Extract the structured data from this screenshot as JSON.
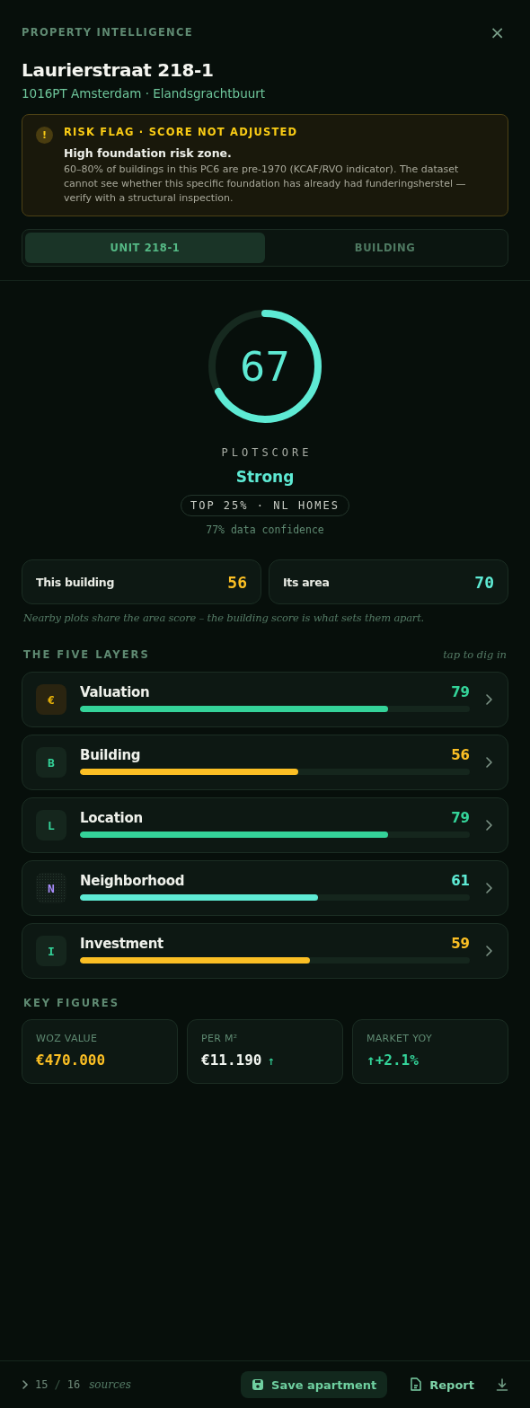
{
  "header": {
    "eyebrow": "PROPERTY INTELLIGENCE",
    "close": "×",
    "title": "Laurierstraat 218-1",
    "subtitle": "1016PT Amsterdam · Elandsgrachtbuurt"
  },
  "alert": {
    "icon": "!",
    "title": "RISK FLAG · SCORE NOT ADJUSTED",
    "headline": "High foundation risk zone.",
    "body": "60–80% of buildings in this PC6 are pre-1970 (KCAF/RVO indicator). The dataset cannot see whether this specific foundation has already had funderingsherstel — verify with a structural inspection."
  },
  "tabs": [
    {
      "label": "UNIT 218-1",
      "selected": true
    },
    {
      "label": "BUILDING",
      "selected": false
    }
  ],
  "score": {
    "value": "67",
    "level": 0.67,
    "label": "PLOTSCORE",
    "rating": "Strong",
    "rank": "TOP 25% · NL HOMES",
    "confidence": "77% data confidence"
  },
  "split": [
    {
      "label": "This building",
      "value": "56",
      "color": "#fbbf24"
    },
    {
      "label": "Its area",
      "value": "70",
      "color": "#5eead4"
    }
  ],
  "split_note": "Nearby plots share the area score – the building score is what sets them apart.",
  "layers_heading": "THE FIVE LAYERS",
  "layers_hint": "tap to dig in",
  "layers": [
    {
      "icon": "€",
      "kind": "currency",
      "name": "Valuation",
      "score": "79",
      "level": 0.79,
      "color": "#34d399"
    },
    {
      "icon": "B",
      "kind": "letter",
      "name": "Building",
      "score": "56",
      "level": 0.56,
      "color": "#fbbf24"
    },
    {
      "icon": "L",
      "kind": "letter",
      "name": "Location",
      "score": "79",
      "level": 0.79,
      "color": "#34d399"
    },
    {
      "icon": "N",
      "kind": "dotted",
      "name": "Neighborhood",
      "score": "61",
      "level": 0.61,
      "color": "#5eead4"
    },
    {
      "icon": "I",
      "kind": "letter",
      "name": "Investment",
      "score": "59",
      "level": 0.59,
      "color": "#fbbf24"
    }
  ],
  "figures_heading": "KEY FIGURES",
  "figures": [
    {
      "label": "WOZ VALUE",
      "value": "€470.000",
      "color": "#fbbf24"
    },
    {
      "label": "PER M²",
      "value": "€11.190",
      "trend": "↑",
      "color": "#f1f5f0"
    },
    {
      "label": "MARKET YOY",
      "value": "↑+2.1%",
      "color": "#34d399"
    }
  ],
  "footer": {
    "count": "15",
    "separator": "/",
    "total": "16",
    "sources": "sources",
    "save": "Save apartment",
    "report": "Report"
  }
}
